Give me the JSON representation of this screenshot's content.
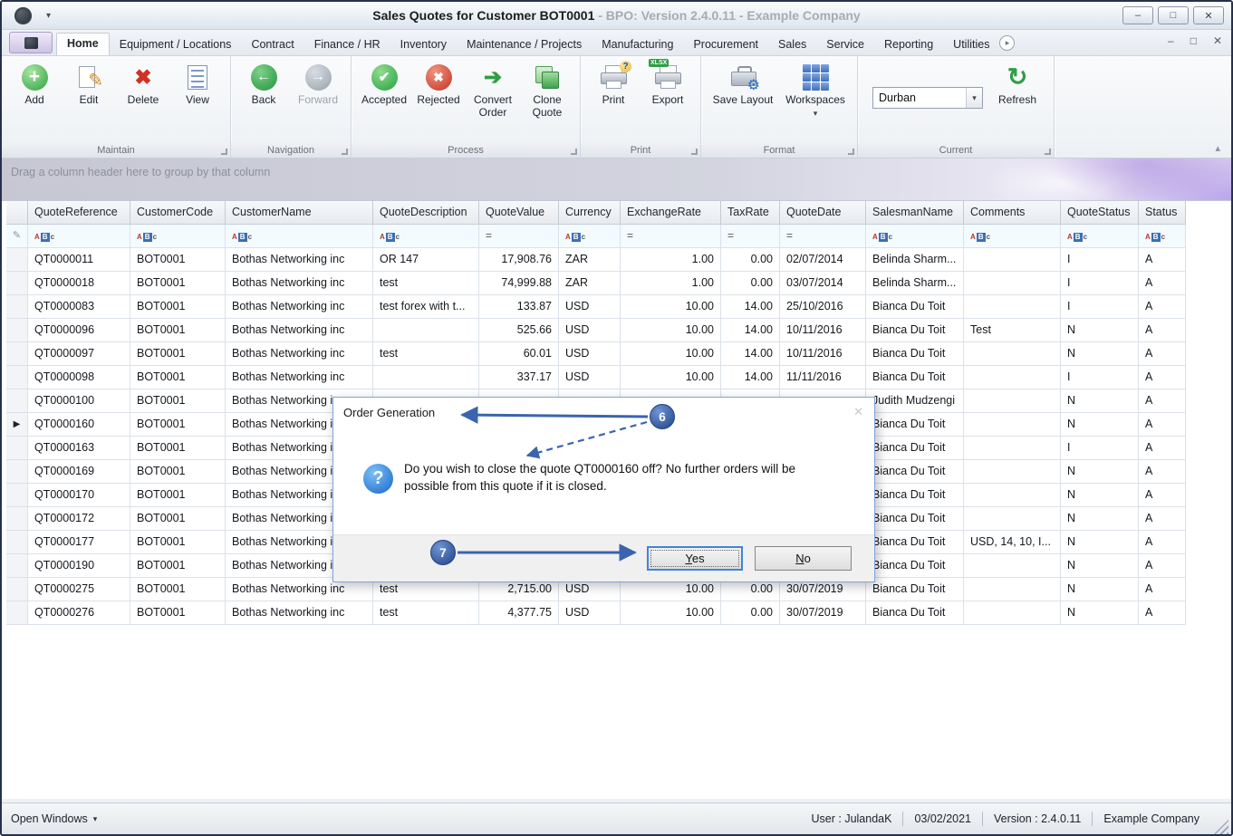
{
  "titlebar": {
    "title_bold": "Sales Quotes for Customer BOT0001",
    "title_gray": " - BPO: Version 2.4.0.11 - Example Company"
  },
  "tabs": {
    "active": "Home",
    "items": [
      "Home",
      "Equipment / Locations",
      "Contract",
      "Finance / HR",
      "Inventory",
      "Maintenance / Projects",
      "Manufacturing",
      "Procurement",
      "Sales",
      "Service",
      "Reporting",
      "Utilities"
    ]
  },
  "ribbon": {
    "maintain": {
      "label": "Maintain",
      "add": "Add",
      "edit": "Edit",
      "delete": "Delete",
      "view": "View"
    },
    "navigation": {
      "label": "Navigation",
      "back": "Back",
      "forward": "Forward"
    },
    "process": {
      "label": "Process",
      "accepted": "Accepted",
      "rejected": "Rejected",
      "convert": "Convert Order",
      "clone": "Clone Quote"
    },
    "print_group": {
      "label": "Print",
      "print": "Print",
      "export": "Export"
    },
    "format": {
      "label": "Format",
      "save_layout": "Save Layout",
      "workspaces": "Workspaces"
    },
    "current": {
      "label": "Current",
      "site": "Durban",
      "refresh": "Refresh"
    }
  },
  "groupbar": {
    "text": "Drag a column header here to group by that column"
  },
  "grid": {
    "columns": [
      "QuoteReference",
      "CustomerCode",
      "CustomerName",
      "QuoteDescription",
      "QuoteValue",
      "Currency",
      "ExchangeRate",
      "TaxRate",
      "QuoteDate",
      "SalesmanName",
      "Comments",
      "QuoteStatus",
      "Status"
    ],
    "filter_types": [
      "text",
      "text",
      "text",
      "text",
      "num",
      "text",
      "num",
      "num",
      "num",
      "text",
      "text",
      "text",
      "text"
    ],
    "selected_row_index": 7,
    "rows": [
      [
        "QT0000011",
        "BOT0001",
        "Bothas Networking inc",
        "OR 147",
        "17,908.76",
        "ZAR",
        "1.00",
        "0.00",
        "02/07/2014",
        "Belinda Sharm...",
        "",
        "I",
        "A"
      ],
      [
        "QT0000018",
        "BOT0001",
        "Bothas Networking inc",
        "test",
        "74,999.88",
        "ZAR",
        "1.00",
        "0.00",
        "03/07/2014",
        "Belinda Sharm...",
        "",
        "I",
        "A"
      ],
      [
        "QT0000083",
        "BOT0001",
        "Bothas Networking inc",
        "test forex with t...",
        "133.87",
        "USD",
        "10.00",
        "14.00",
        "25/10/2016",
        "Bianca Du Toit",
        "",
        "I",
        "A"
      ],
      [
        "QT0000096",
        "BOT0001",
        "Bothas Networking inc",
        "",
        "525.66",
        "USD",
        "10.00",
        "14.00",
        "10/11/2016",
        "Bianca Du Toit",
        "Test",
        "N",
        "A"
      ],
      [
        "QT0000097",
        "BOT0001",
        "Bothas Networking inc",
        "test",
        "60.01",
        "USD",
        "10.00",
        "14.00",
        "10/11/2016",
        "Bianca Du Toit",
        "",
        "N",
        "A"
      ],
      [
        "QT0000098",
        "BOT0001",
        "Bothas Networking inc",
        "",
        "337.17",
        "USD",
        "10.00",
        "14.00",
        "11/11/2016",
        "Bianca Du Toit",
        "",
        "I",
        "A"
      ],
      [
        "QT0000100",
        "BOT0001",
        "Bothas Networking inc",
        "",
        "",
        "",
        "",
        "",
        "",
        "Judith Mudzengi",
        "",
        "N",
        "A"
      ],
      [
        "QT0000160",
        "BOT0001",
        "Bothas Networking inc",
        "",
        "",
        "",
        "",
        "",
        "",
        "Bianca Du Toit",
        "",
        "N",
        "A"
      ],
      [
        "QT0000163",
        "BOT0001",
        "Bothas Networking inc",
        "",
        "",
        "",
        "",
        "",
        "",
        "Bianca Du Toit",
        "",
        "I",
        "A"
      ],
      [
        "QT0000169",
        "BOT0001",
        "Bothas Networking inc",
        "",
        "",
        "",
        "",
        "",
        "",
        "Bianca Du Toit",
        "",
        "N",
        "A"
      ],
      [
        "QT0000170",
        "BOT0001",
        "Bothas Networking inc",
        "",
        "",
        "",
        "",
        "",
        "",
        "Bianca Du Toit",
        "",
        "N",
        "A"
      ],
      [
        "QT0000172",
        "BOT0001",
        "Bothas Networking inc",
        "",
        "",
        "",
        "",
        "",
        "",
        "Bianca Du Toit",
        "",
        "N",
        "A"
      ],
      [
        "QT0000177",
        "BOT0001",
        "Bothas Networking inc",
        "",
        "",
        "",
        "",
        "",
        "",
        "Bianca Du Toit",
        "USD, 14, 10, I...",
        "N",
        "A"
      ],
      [
        "QT0000190",
        "BOT0001",
        "Bothas Networking inc",
        "",
        "",
        "",
        "",
        "",
        "",
        "Bianca Du Toit",
        "",
        "N",
        "A"
      ],
      [
        "QT0000275",
        "BOT0001",
        "Bothas Networking inc",
        "test",
        "2,715.00",
        "USD",
        "10.00",
        "0.00",
        "30/07/2019",
        "Bianca Du Toit",
        "",
        "N",
        "A"
      ],
      [
        "QT0000276",
        "BOT0001",
        "Bothas Networking inc",
        "test",
        "4,377.75",
        "USD",
        "10.00",
        "0.00",
        "30/07/2019",
        "Bianca Du Toit",
        "",
        "N",
        "A"
      ]
    ]
  },
  "dialog": {
    "title": "Order Generation",
    "message_line1": "Do you wish to close the quote QT0000160 off? No further orders will be",
    "message_line2": "possible from this quote if it is closed.",
    "yes_label": "Yes",
    "no_label": "No"
  },
  "callouts": {
    "six": "6",
    "seven": "7"
  },
  "statusbar": {
    "open_windows": "Open Windows",
    "user": "User : JulandaK",
    "date": "03/02/2021",
    "version": "Version : 2.4.0.11",
    "company": "Example Company"
  },
  "icons": {
    "plus": "+",
    "pencil": "✎",
    "delete_x": "✖",
    "back_arrow": "←",
    "forward_arrow": "→",
    "check": "✔",
    "reject_x": "✖",
    "convert_arrow": "➔",
    "refresh": "↻",
    "gear": "⚙",
    "chevron_down": "▾",
    "collapse": "▴",
    "minimize": "–",
    "maximize": "□",
    "close": "✕",
    "restore": "□",
    "tab_scroll": "▸",
    "question": "?",
    "xlsx_badge": "XLSX",
    "row_arrow": "▶",
    "equals": "=",
    "filter_abc": "ABc",
    "filter_pencil": "✎",
    "dialog_close": "✕",
    "open_windows_caret": "▾"
  }
}
